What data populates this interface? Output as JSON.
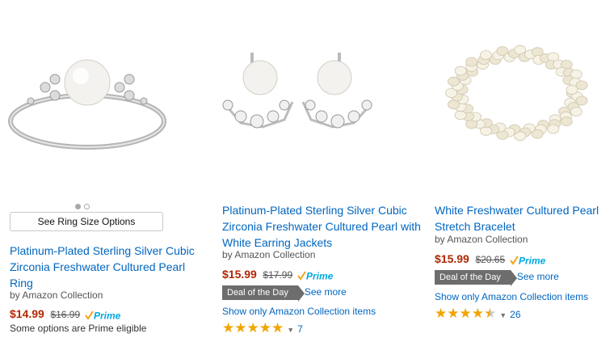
{
  "products": [
    {
      "title": "Platinum-Plated Sterling Silver Cubic Zirconia Freshwater Cultured Pearl Ring",
      "by": "by Amazon Collection",
      "price": "$14.99",
      "old_price": "$16.99",
      "size_button": "See Ring Size Options",
      "note": "Some options are Prime eligible",
      "image": "pearl-ring",
      "carousel_dots": 2
    },
    {
      "title": "Platinum-Plated Sterling Silver Cubic Zirconia Freshwater Cultured Pearl with White Earring Jackets",
      "by": "by Amazon Collection",
      "price": "$15.99",
      "old_price": "$17.99",
      "deal": "Deal of the Day",
      "see_more": "See more",
      "show_only": "Show only Amazon Collection items",
      "rating": 5,
      "reviews": "7",
      "image": "pearl-earrings"
    },
    {
      "title": "White Freshwater Cultured Pearl Stretch Bracelet",
      "by": "by Amazon Collection",
      "price": "$15.99",
      "old_price": "$20.65",
      "deal": "Deal of the Day",
      "see_more": "See more",
      "show_only": "Show only Amazon Collection items",
      "rating": 4.5,
      "reviews": "26",
      "image": "pearl-bracelet"
    }
  ],
  "prime_label": "Prime",
  "colors": {
    "link": "#0066c0",
    "price": "#b12704",
    "star": "#f0a500",
    "prime": "#00a8e1"
  }
}
